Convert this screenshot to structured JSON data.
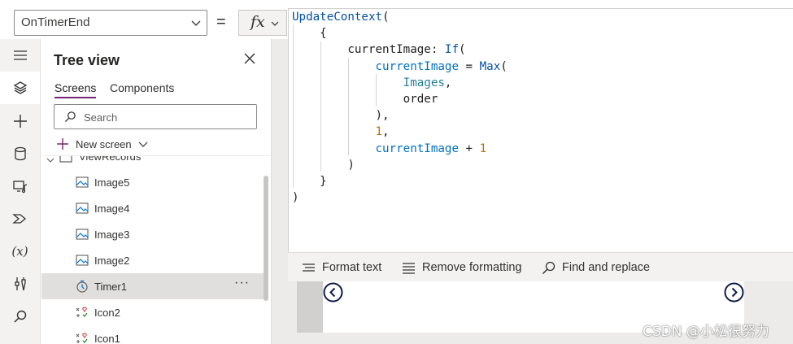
{
  "formula_bar": {
    "property": "OnTimerEnd",
    "equals": "=",
    "fx": "fx"
  },
  "tree_view": {
    "title": "Tree view",
    "tabs": [
      "Screens",
      "Components"
    ],
    "search_placeholder": "Search",
    "new_screen": "New screen",
    "parent_label": "ViewRecords",
    "items": [
      {
        "label": "Image5",
        "icon": "image-icon"
      },
      {
        "label": "Image4",
        "icon": "image-icon"
      },
      {
        "label": "Image3",
        "icon": "image-icon"
      },
      {
        "label": "Image2",
        "icon": "image-icon"
      },
      {
        "label": "Timer1",
        "icon": "timer-icon",
        "selected": true
      },
      {
        "label": "Icon2",
        "icon": "icon-control-icon"
      },
      {
        "label": "Icon1",
        "icon": "icon-control-icon"
      }
    ],
    "more": "···"
  },
  "rail": {
    "icons": [
      "hamburger-icon",
      "layers-icon",
      "plus-icon",
      "database-icon",
      "media-icon",
      "power-automate-icon",
      "variables-icon",
      "tools-icon",
      "search-icon"
    ],
    "variables_glyph": "(x)"
  },
  "code": {
    "lines": [
      [
        {
          "t": "UpdateContext",
          "c": "fn"
        },
        {
          "t": "(",
          "c": "pl"
        }
      ],
      [
        {
          "t": "    {",
          "c": "pl"
        }
      ],
      [
        {
          "t": "        currentImage: ",
          "c": "pl"
        },
        {
          "t": "If",
          "c": "fn"
        },
        {
          "t": "(",
          "c": "pl"
        }
      ],
      [
        {
          "t": "            ",
          "c": "pl"
        },
        {
          "t": "currentImage",
          "c": "var"
        },
        {
          "t": " = ",
          "c": "pl"
        },
        {
          "t": "Max",
          "c": "fn"
        },
        {
          "t": "(",
          "c": "pl"
        }
      ],
      [
        {
          "t": "                ",
          "c": "pl"
        },
        {
          "t": "Images",
          "c": "tbl"
        },
        {
          "t": ",",
          "c": "pl"
        }
      ],
      [
        {
          "t": "                order",
          "c": "pl"
        }
      ],
      [
        {
          "t": "            ),",
          "c": "pl"
        }
      ],
      [
        {
          "t": "            ",
          "c": "pl"
        },
        {
          "t": "1",
          "c": "num"
        },
        {
          "t": ",",
          "c": "pl"
        }
      ],
      [
        {
          "t": "            ",
          "c": "pl"
        },
        {
          "t": "currentImage",
          "c": "var"
        },
        {
          "t": " + ",
          "c": "pl"
        },
        {
          "t": "1",
          "c": "num"
        }
      ],
      [
        {
          "t": "        )",
          "c": "pl"
        }
      ],
      [
        {
          "t": "    }",
          "c": "pl"
        }
      ],
      [
        {
          "t": ")",
          "c": "pl"
        }
      ]
    ]
  },
  "editor_toolbar": {
    "format_text": "Format text",
    "remove_formatting": "Remove formatting",
    "find_replace": "Find and replace"
  },
  "watermark": "CSDN @小松很努力",
  "colors": {
    "accent": "#742774",
    "nav_circle": "#0f1b4c"
  }
}
